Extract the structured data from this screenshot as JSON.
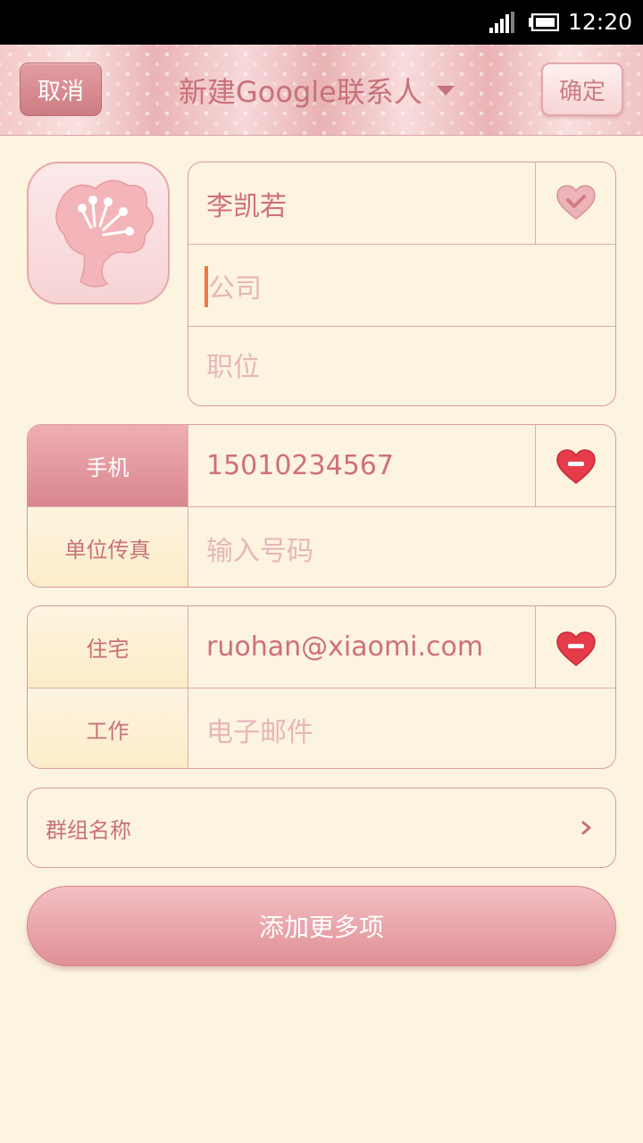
{
  "status_bar": {
    "time": "12:20",
    "signal_icon": "signal-icon",
    "battery_icon": "battery-icon"
  },
  "header": {
    "cancel_label": "取消",
    "title": "新建Google联系人",
    "ok_label": "确定"
  },
  "avatar": {
    "icon": "flower-icon"
  },
  "name_card": {
    "name_value": "李凯若",
    "company_placeholder": "公司",
    "title_placeholder": "职位",
    "icon": "heart-check-icon"
  },
  "phone_card": {
    "rows": [
      {
        "label": "手机",
        "value": "15010234567",
        "icon": "heart-remove-icon"
      },
      {
        "label": "单位传真",
        "placeholder": "输入号码"
      }
    ]
  },
  "email_card": {
    "rows": [
      {
        "label": "住宅",
        "value": "ruohan@xiaomi.com",
        "icon": "heart-remove-icon"
      },
      {
        "label": "工作",
        "placeholder": "电子邮件"
      }
    ]
  },
  "group": {
    "label": "群组名称",
    "icon": "chevron-right-icon"
  },
  "add_more": {
    "label": "添加更多项"
  },
  "colors": {
    "accent": "#cf6f7a",
    "background": "#fdf4e0",
    "cursor": "#f07840"
  }
}
